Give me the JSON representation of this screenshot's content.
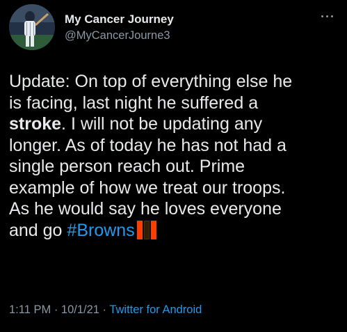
{
  "author": {
    "display_name": "My Cancer Journey",
    "handle": "@MyCancerJourne3"
  },
  "tweet": {
    "lines": [
      {
        "text": "Update: On top of everything else he"
      },
      {
        "text": "is facing, last night he suffered a"
      },
      {
        "bold": "stroke",
        "text": ". I will not be updating any"
      },
      {
        "text": "longer. As of today he has not had a"
      },
      {
        "text": "single person reach out. Prime"
      },
      {
        "text": "example of how we treat our troops."
      },
      {
        "text": "As he would say he loves everyone"
      },
      {
        "text": "and go ",
        "hashtag": "#Browns"
      }
    ],
    "emoji": "browns-stripes-emoji"
  },
  "meta": {
    "time": "1:11 PM",
    "sep1": " · ",
    "date": "10/1/21",
    "sep2": " · ",
    "source": "Twitter for Android"
  },
  "colors": {
    "background": "#000000",
    "text": "#e7e9ea",
    "secondary": "#8b98a5",
    "link": "#1d9bf0",
    "browns_orange": "#FF3C00",
    "browns_brown": "#311D00"
  }
}
